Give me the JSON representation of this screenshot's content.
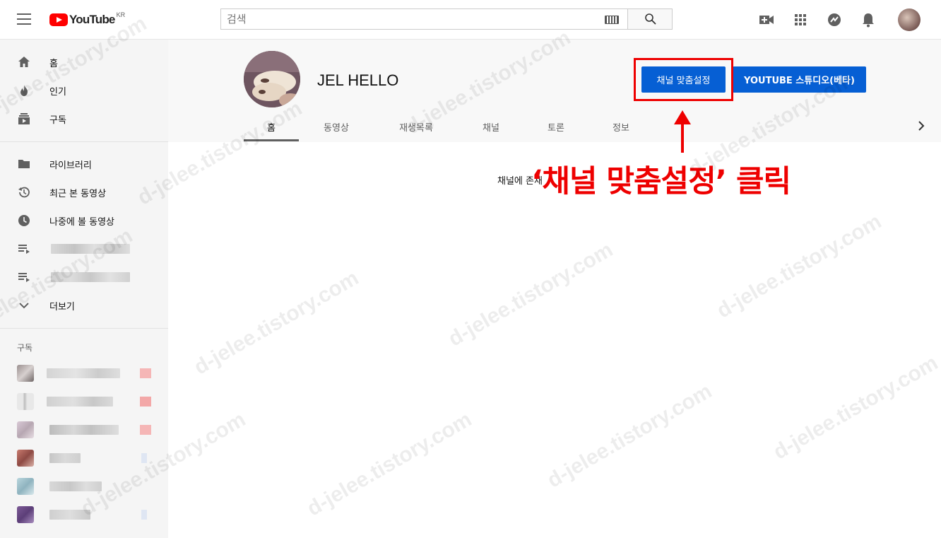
{
  "header": {
    "logo_text": "YouTube",
    "logo_region": "KR",
    "search_placeholder": "검색"
  },
  "sidebar": {
    "primary": [
      {
        "label": "홈",
        "icon": "home-icon"
      },
      {
        "label": "인기",
        "icon": "flame-icon"
      },
      {
        "label": "구독",
        "icon": "subscriptions-icon"
      }
    ],
    "library": [
      {
        "label": "라이브러리",
        "icon": "folder-icon"
      },
      {
        "label": "최근 본 동영상",
        "icon": "history-icon"
      },
      {
        "label": "나중에 볼 동영상",
        "icon": "clock-icon"
      }
    ],
    "more_label": "더보기",
    "subscriptions_heading": "구독"
  },
  "channel": {
    "name": "JEL HELLO",
    "customize_button": "채널 맞춤설정",
    "studio_button": "YOUTUBE 스튜디오(베타)",
    "tabs": [
      "홈",
      "동영상",
      "재생목록",
      "채널",
      "토론",
      "정보"
    ],
    "active_tab": "홈",
    "empty_message": "채널에 존재"
  },
  "annotation": {
    "text": "‘채널 맞춤설정’ 클릭",
    "color": "#ee0000"
  },
  "watermark": "d-jelee.tistory.com",
  "colors": {
    "brand_red": "#ff0000",
    "button_blue": "#065fd4",
    "sidebar_bg": "#f5f5f5"
  }
}
